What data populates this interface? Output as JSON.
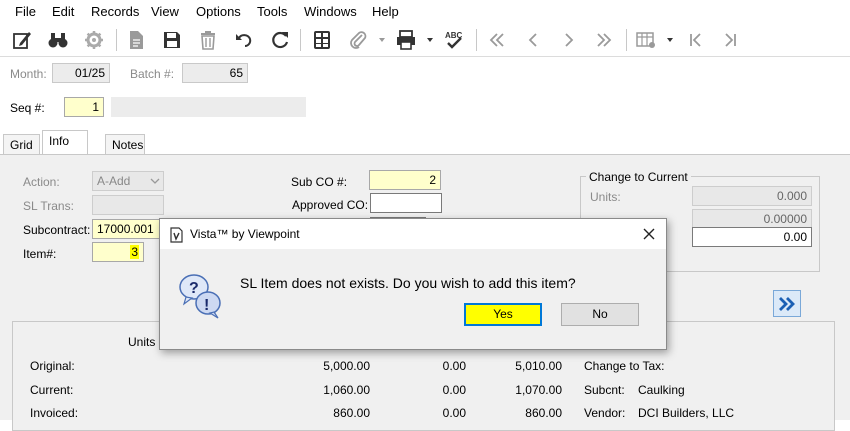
{
  "menu": [
    "File",
    "Edit",
    "Records",
    "View",
    "Options",
    "Tools",
    "Windows",
    "Help"
  ],
  "header": {
    "month_label": "Month:",
    "month_value": "01/25",
    "batch_label": "Batch #:",
    "batch_value": "65",
    "seq_label": "Seq #:",
    "seq_value": "1"
  },
  "tabs": [
    "Grid",
    "Info",
    "Notes"
  ],
  "info": {
    "action_label": "Action:",
    "action_value": "A-Add",
    "sl_trans_label": "SL Trans:",
    "subcontract_label": "Subcontract:",
    "subcontract_value": "17000.001",
    "item_label": "Item#:",
    "item_value": "3",
    "sub_co_label": "Sub CO #:",
    "sub_co_value": "2",
    "approved_co_label": "Approved CO:",
    "change_current_title": "Change to Current",
    "units_label": "Units:",
    "units_value": "0.000",
    "unit_cost_value": "0.00000",
    "amount_value": "0.00"
  },
  "summary": {
    "units_header": "Units",
    "rows": [
      {
        "label": "Original:",
        "units": "5,000.00",
        "mid": "0.00",
        "total": "5,010.00"
      },
      {
        "label": "Current:",
        "units": "1,060.00",
        "mid": "0.00",
        "total": "1,070.00"
      },
      {
        "label": "Invoiced:",
        "units": "860.00",
        "mid": "0.00",
        "total": "860.00"
      }
    ],
    "right": [
      {
        "label": "Change to Tax:",
        "value": ""
      },
      {
        "label": "Subcnt:",
        "value": "Caulking"
      },
      {
        "label": "Vendor:",
        "value": "DCI Builders, LLC"
      }
    ]
  },
  "dialog": {
    "title": "Vista™ by Viewpoint",
    "message": "SL Item does not exists.  Do you wish to add this item?",
    "yes_label": "Yes",
    "no_label": "No"
  },
  "colors": {
    "required_field": "#ffffcc",
    "yes_highlight": "#ffff00",
    "focus_border": "#0078d7"
  }
}
